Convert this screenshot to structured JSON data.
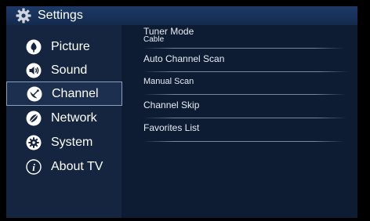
{
  "header": {
    "title": "Settings",
    "icon": "gear-icon"
  },
  "sidebar": {
    "items": [
      {
        "label": "Picture",
        "icon": "picture-icon"
      },
      {
        "label": "Sound",
        "icon": "speaker-icon"
      },
      {
        "label": "Channel",
        "icon": "satellite-dish-icon",
        "selected": true
      },
      {
        "label": "Network",
        "icon": "network-icon"
      },
      {
        "label": "System",
        "icon": "system-gear-icon"
      },
      {
        "label": "About TV",
        "icon": "info-icon"
      }
    ]
  },
  "submenu": {
    "tuner_mode_label": "Tuner Mode",
    "tuner_mode_value": "Cable",
    "items": [
      {
        "label": "Auto Channel Scan"
      },
      {
        "label": "Manual Scan"
      },
      {
        "label": "Channel Skip"
      },
      {
        "label": "Favorites List"
      }
    ]
  },
  "colors": {
    "header_bg": "#1a3560",
    "sidebar_bg": "#15253f",
    "content_bg": "#0e1c33",
    "selected_border": "#8aa0c0"
  }
}
